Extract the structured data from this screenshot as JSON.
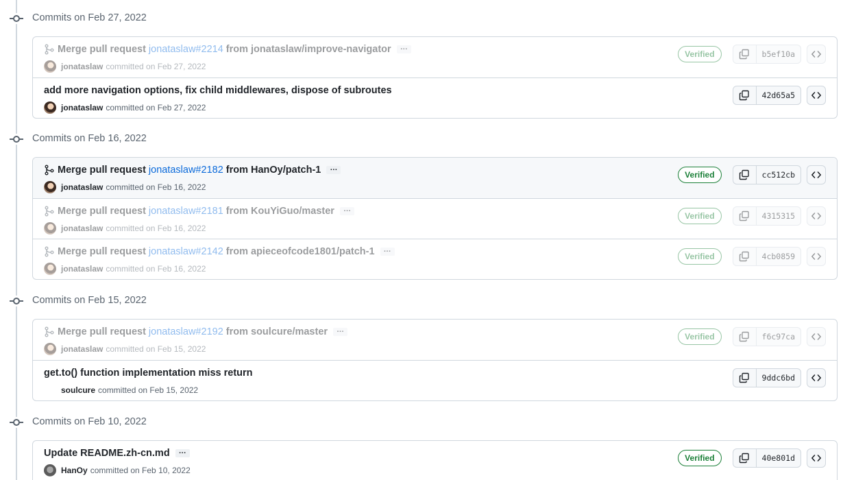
{
  "groups": [
    {
      "title": "Commits on Feb 27, 2022",
      "commits": [
        {
          "title": "Merge pull request",
          "pr": "jonataslaw#2214",
          "from": "from jonataslaw/improve-navigator",
          "author": "jonataslaw",
          "committed": "committed on Feb 27, 2022",
          "verified": "Verified",
          "sha": "b5ef10a",
          "ellipsis": "…"
        },
        {
          "title": "add more navigation options, fix child middlewares, dispose of subroutes",
          "author": "jonataslaw",
          "committed": "committed on Feb 27, 2022",
          "sha": "42d65a5"
        }
      ]
    },
    {
      "title": "Commits on Feb 16, 2022",
      "commits": [
        {
          "title": "Merge pull request",
          "pr": "jonataslaw#2182",
          "from": "from HanOy/patch-1",
          "author": "jonataslaw",
          "committed": "committed on Feb 16, 2022",
          "verified": "Verified",
          "sha": "cc512cb",
          "ellipsis": "…"
        },
        {
          "title": "Merge pull request",
          "pr": "jonataslaw#2181",
          "from": "from KouYiGuo/master",
          "author": "jonataslaw",
          "committed": "committed on Feb 16, 2022",
          "verified": "Verified",
          "sha": "4315315",
          "ellipsis": "…"
        },
        {
          "title": "Merge pull request",
          "pr": "jonataslaw#2142",
          "from": "from apieceofcode1801/patch-1",
          "author": "jonataslaw",
          "committed": "committed on Feb 16, 2022",
          "verified": "Verified",
          "sha": "4cb0859",
          "ellipsis": "…"
        }
      ]
    },
    {
      "title": "Commits on Feb 15, 2022",
      "commits": [
        {
          "title": "Merge pull request",
          "pr": "jonataslaw#2192",
          "from": "from soulcure/master",
          "author": "jonataslaw",
          "committed": "committed on Feb 15, 2022",
          "verified": "Verified",
          "sha": "f6c97ca",
          "ellipsis": "…"
        },
        {
          "title": "get.to() function implementation miss return",
          "author": "soulcure",
          "committed": "committed on Feb 15, 2022",
          "sha": "9ddc6bd"
        }
      ]
    },
    {
      "title": "Commits on Feb 10, 2022",
      "commits": [
        {
          "title": "Update README.zh-cn.md",
          "author": "HanOy",
          "committed": "committed on Feb 10, 2022",
          "verified": "Verified",
          "sha": "40e801d",
          "ellipsis": "…"
        }
      ]
    }
  ],
  "icons": {
    "merge": "git-merge-icon",
    "copy": "copy-icon",
    "browse": "code-icon",
    "timeline": "git-commit-icon"
  },
  "colors": {
    "verified": "#1a7f37",
    "link": "#0969da",
    "muted": "#59636e",
    "border": "#d0d7de"
  }
}
